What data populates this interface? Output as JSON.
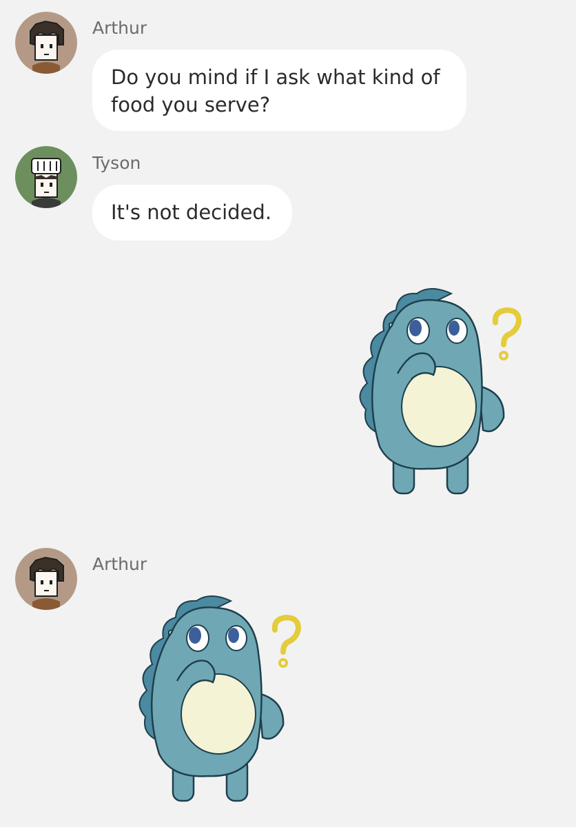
{
  "messages": [
    {
      "sender": "Arthur",
      "avatar": "arthur-avatar",
      "text": "Do you mind if I ask what kind of food you serve?"
    },
    {
      "sender": "Tyson",
      "avatar": "tyson-chef-avatar",
      "text": "It's not decided."
    },
    {
      "sender": "Tyson",
      "sticker": "thinking-dinosaur-sticker"
    },
    {
      "sender": "Arthur",
      "avatar": "arthur-avatar",
      "sticker": "thinking-dinosaur-sticker"
    }
  ],
  "colors": {
    "background": "#f2f2f2",
    "bubble": "#ffffff",
    "arthur_avatar_bg": "#b49a86",
    "tyson_avatar_bg": "#6d8f5e",
    "dino_body": "#6fa8b4",
    "dino_spikes": "#4b8aa0",
    "dino_belly": "#f4f3d6",
    "question_mark": "#e4cc3a"
  }
}
